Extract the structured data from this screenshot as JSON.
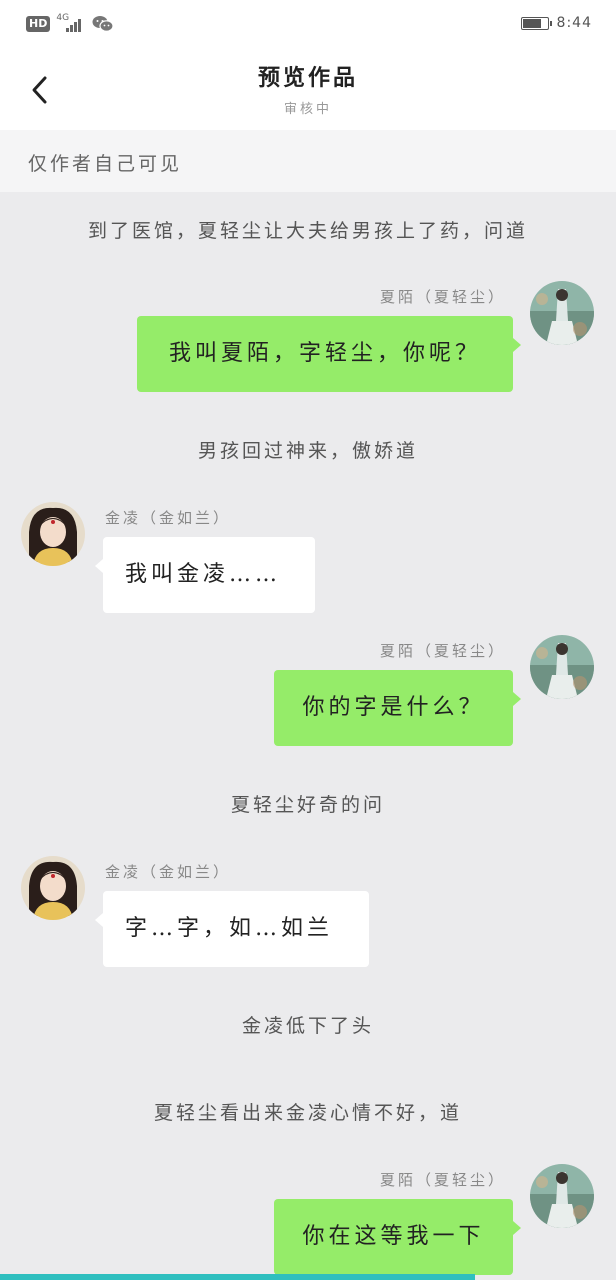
{
  "status_bar": {
    "hd": "HD",
    "network": "4G",
    "time": "8:44"
  },
  "header": {
    "title": "预览作品",
    "subtitle": "审核中"
  },
  "notice": "仅作者自己可见",
  "chat": {
    "narration_1": "到了医馆，夏轻尘让大夫给男孩上了药，问道",
    "msg_1": {
      "name": "夏陌（夏轻尘）",
      "text": "我叫夏陌，字轻尘，你呢？"
    },
    "narration_2": "男孩回过神来，傲娇道",
    "msg_2": {
      "name": "金凌（金如兰）",
      "text": "我叫金凌……"
    },
    "msg_3": {
      "name": "夏陌（夏轻尘）",
      "text": "你的字是什么？"
    },
    "narration_3": "夏轻尘好奇的问",
    "msg_4": {
      "name": "金凌（金如兰）",
      "text": "字…字，如…如兰"
    },
    "narration_4": "金凌低下了头",
    "narration_5": "夏轻尘看出来金凌心情不好，道",
    "msg_5": {
      "name": "夏陌（夏轻尘）",
      "text": "你在这等我一下"
    }
  },
  "colors": {
    "sent_bubble": "#95ec69",
    "received_bubble": "#ffffff",
    "background": "#ebebed"
  }
}
